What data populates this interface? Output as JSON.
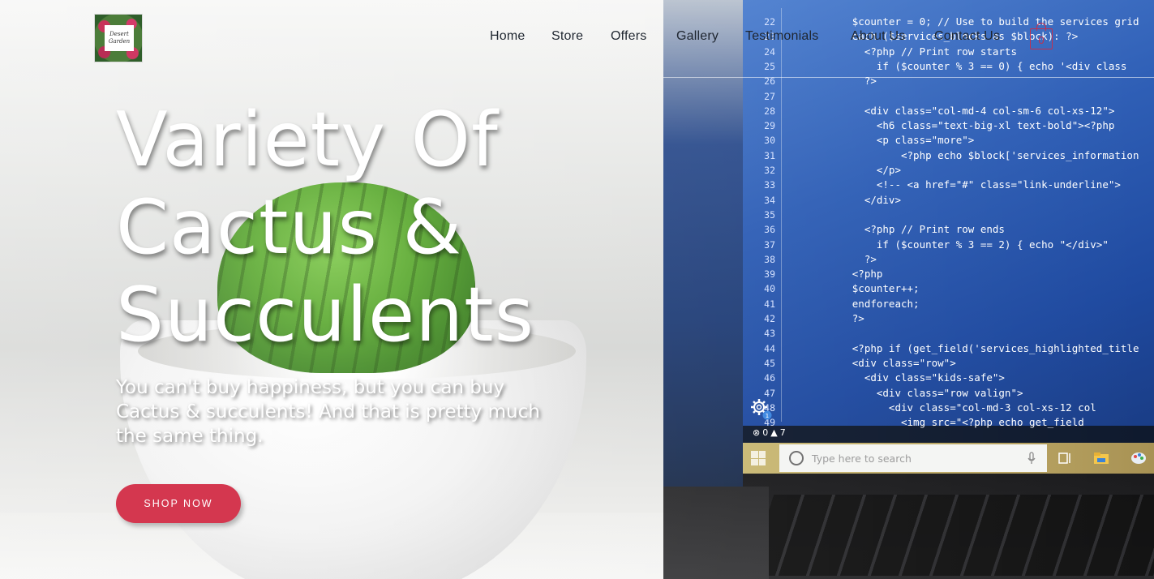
{
  "brand": {
    "logo_line1": "Desert",
    "logo_line2": "Garden"
  },
  "nav": {
    "items": [
      {
        "label": "Home"
      },
      {
        "label": "Store"
      },
      {
        "label": "Offers"
      },
      {
        "label": "Gallery"
      },
      {
        "label": "Testimonials"
      },
      {
        "label": "About Us"
      },
      {
        "label": "Contact Us"
      }
    ],
    "cart_count": "0"
  },
  "hero": {
    "title_line1": "Variety Of",
    "title_line2": "Cactus &",
    "title_line3": "Succulents",
    "subtitle": "You can't buy happiness, but you can buy Cactus & succulents! And that is pretty much the same thing.",
    "cta_label": "SHOP NOW"
  },
  "background_code": {
    "lines": [
      {
        "n": "22",
        "text": "           $counter = 0; // Use to build the services grid"
      },
      {
        "n": "23",
        "text": "           each ($services_blocks as $block): ?>"
      },
      {
        "n": "24",
        "text": "             <?php // Print row starts"
      },
      {
        "n": "25",
        "text": "               if ($counter % 3 == 0) { echo '<div class"
      },
      {
        "n": "26",
        "text": "             ?>"
      },
      {
        "n": "27",
        "text": ""
      },
      {
        "n": "28",
        "text": "             <div class=\"col-md-4 col-sm-6 col-xs-12\">"
      },
      {
        "n": "29",
        "text": "               <h6 class=\"text-big-xl text-bold\"><?php"
      },
      {
        "n": "30",
        "text": "               <p class=\"more\">"
      },
      {
        "n": "31",
        "text": "                   <?php echo $block['services_information"
      },
      {
        "n": "32",
        "text": "               </p>"
      },
      {
        "n": "33",
        "text": "               <!-- <a href=\"#\" class=\"link-underline\">"
      },
      {
        "n": "34",
        "text": "             </div>"
      },
      {
        "n": "35",
        "text": ""
      },
      {
        "n": "36",
        "text": "             <?php // Print row ends"
      },
      {
        "n": "37",
        "text": "               if ($counter % 3 == 2) { echo \"</div>\""
      },
      {
        "n": "38",
        "text": "             ?>"
      },
      {
        "n": "39",
        "text": "           <?php"
      },
      {
        "n": "40",
        "text": "           $counter++;"
      },
      {
        "n": "41",
        "text": "           endforeach;"
      },
      {
        "n": "42",
        "text": "           ?>"
      },
      {
        "n": "43",
        "text": ""
      },
      {
        "n": "44",
        "text": "           <?php if (get_field('services_highlighted_title"
      },
      {
        "n": "45",
        "text": "           <div class=\"row\">"
      },
      {
        "n": "46",
        "text": "             <div class=\"kids-safe\">"
      },
      {
        "n": "47",
        "text": "               <div class=\"row valign\">"
      },
      {
        "n": "48",
        "text": "                 <div class=\"col-md-3 col-xs-12 col"
      },
      {
        "n": "49",
        "text": "                   <img src=\"<?php echo get_field"
      }
    ],
    "status_errors": "0",
    "status_warnings": "7",
    "gear_badge": "1",
    "taskbar_search_placeholder": "Type here to search"
  },
  "colors": {
    "accent": "#d4374f",
    "cart": "#c3304f",
    "nav_text": "#1f2630"
  }
}
